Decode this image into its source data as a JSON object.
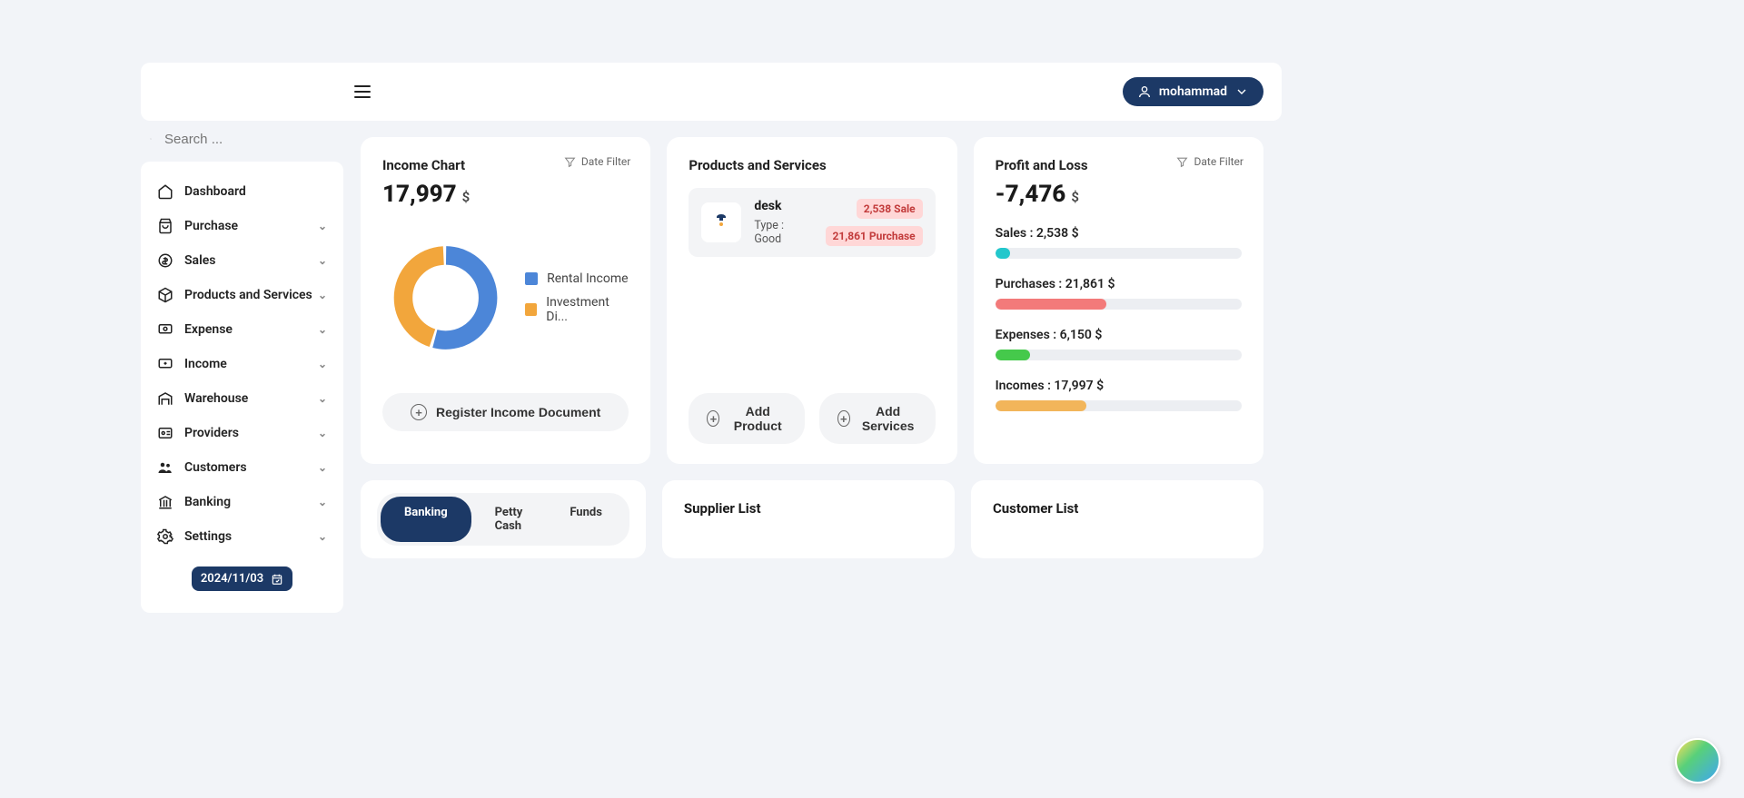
{
  "header": {
    "user": "mohammad"
  },
  "search": {
    "placeholder": "Search ..."
  },
  "sidebar": {
    "items": [
      {
        "label": "Dashboard",
        "expandable": false
      },
      {
        "label": "Purchase",
        "expandable": true
      },
      {
        "label": "Sales",
        "expandable": true
      },
      {
        "label": "Products and Services",
        "expandable": true
      },
      {
        "label": "Expense",
        "expandable": true
      },
      {
        "label": "Income",
        "expandable": true
      },
      {
        "label": "Warehouse",
        "expandable": true
      },
      {
        "label": "Providers",
        "expandable": true
      },
      {
        "label": "Customers",
        "expandable": true
      },
      {
        "label": "Banking",
        "expandable": true
      },
      {
        "label": "Settings",
        "expandable": true
      }
    ],
    "date": "2024/11/03"
  },
  "filters": {
    "date_filter": "Date Filter"
  },
  "income_card": {
    "title": "Income Chart",
    "value": "17,997",
    "currency": "$",
    "legend": [
      "Rental Income",
      "Investment Di..."
    ],
    "action": "Register Income Document"
  },
  "chart_data": {
    "type": "pie",
    "title": "Income Chart",
    "series": [
      {
        "name": "Rental Income",
        "value": 55,
        "color": "#4c86d8"
      },
      {
        "name": "Investment Dividends",
        "value": 45,
        "color": "#f2a63c"
      }
    ],
    "total_label": "17,997 $",
    "style": "donut"
  },
  "products_card": {
    "title": "Products and Services",
    "item": {
      "name": "desk",
      "type_label": "Type : Good",
      "sale_tag": "2,538 Sale",
      "purchase_tag": "21,861 Purchase"
    },
    "add_product": "Add Product",
    "add_services": "Add Services"
  },
  "pl_card": {
    "title": "Profit and Loss",
    "value": "-7,476",
    "currency": "$",
    "metrics": [
      {
        "label": "Sales : 2,538 $",
        "pct": 6,
        "color": "#23c7cc"
      },
      {
        "label": "Purchases : 21,861 $",
        "pct": 45,
        "color": "#f37a7a"
      },
      {
        "label": "Expenses : 6,150 $",
        "pct": 14,
        "color": "#45c94b"
      },
      {
        "label": "Incomes : 17,997 $",
        "pct": 37,
        "color": "#f2b55a"
      }
    ]
  },
  "bottom": {
    "tabs": [
      "Banking",
      "Petty Cash",
      "Funds"
    ],
    "active_tab": 0,
    "supplier_title": "Supplier List",
    "customer_title": "Customer List"
  }
}
